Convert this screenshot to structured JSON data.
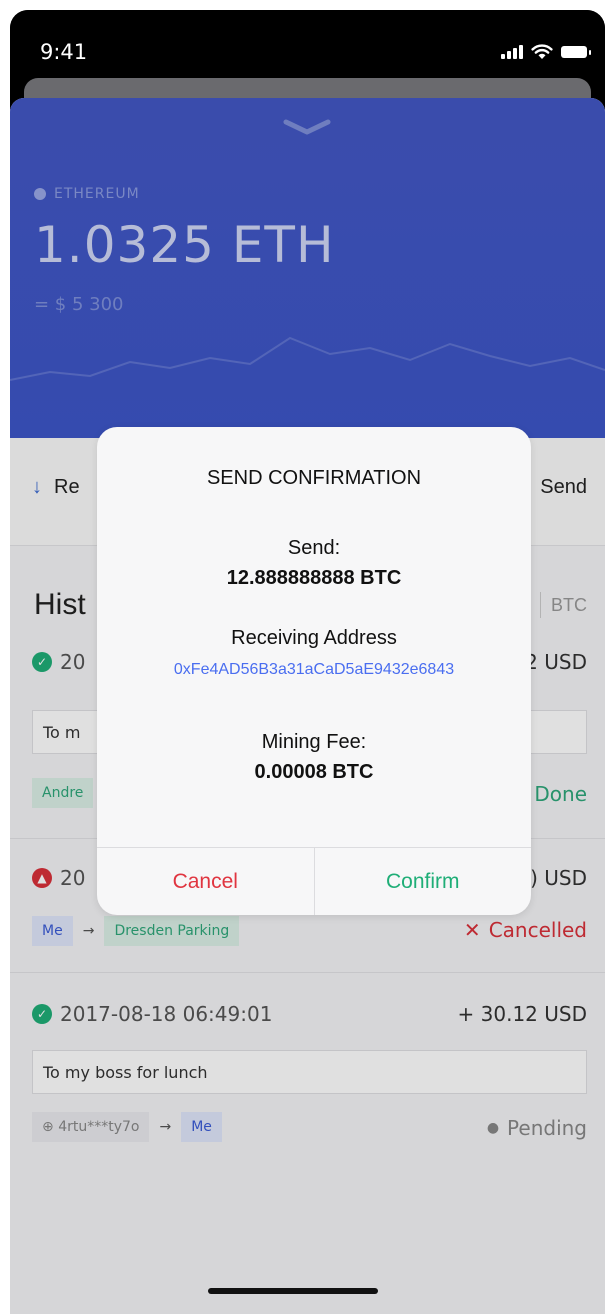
{
  "status_bar": {
    "time": "9:41"
  },
  "wallet": {
    "coin_name": "ETHEREUM",
    "balance": "1.0325 ETH",
    "fiat_value": "= $ 5 300"
  },
  "actions": {
    "receive_label": "Re",
    "send_label": "Send"
  },
  "history": {
    "title": "Hist",
    "currency_usd": "",
    "currency_btc": "BTC",
    "transactions": [
      {
        "date": "20",
        "amount": "2 USD",
        "memo": "To m",
        "tags": [
          "Andre"
        ],
        "status": "Done"
      },
      {
        "date": "20",
        "amount": ") USD",
        "from": "Me",
        "to": "Dresden Parking",
        "status": "Cancelled"
      },
      {
        "date": "2017-08-18 06:49:01",
        "amount": "+ 30.12 USD",
        "memo": "To my boss for lunch",
        "from": "4rtu***ty7o",
        "to": "Me",
        "status": "Pending"
      }
    ]
  },
  "modal": {
    "title": "SEND CONFIRMATION",
    "send_label": "Send:",
    "send_amount": "12.888888888 BTC",
    "address_label": "Receiving Address",
    "address": "0xFe4AD56B3a31aCaD5aE9432e6843",
    "fee_label": "Mining Fee:",
    "fee_amount": "0.00008 BTC",
    "cancel_label": "Cancel",
    "confirm_label": "Confirm"
  },
  "colors": {
    "hero": "#3d56c8",
    "confirm": "#1fae77",
    "cancel": "#e03540",
    "address_link": "#4a6ef0"
  }
}
